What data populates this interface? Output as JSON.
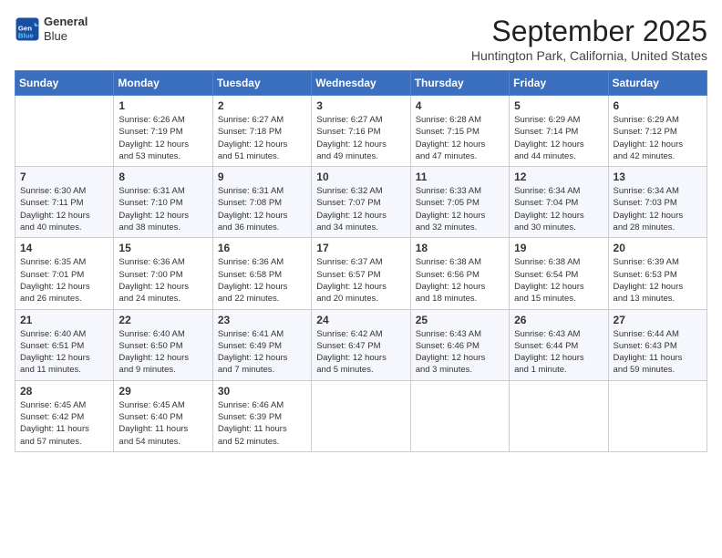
{
  "header": {
    "logo_line1": "General",
    "logo_line2": "Blue",
    "month": "September 2025",
    "location": "Huntington Park, California, United States"
  },
  "weekdays": [
    "Sunday",
    "Monday",
    "Tuesday",
    "Wednesday",
    "Thursday",
    "Friday",
    "Saturday"
  ],
  "weeks": [
    [
      {
        "day": "",
        "info": ""
      },
      {
        "day": "1",
        "info": "Sunrise: 6:26 AM\nSunset: 7:19 PM\nDaylight: 12 hours\nand 53 minutes."
      },
      {
        "day": "2",
        "info": "Sunrise: 6:27 AM\nSunset: 7:18 PM\nDaylight: 12 hours\nand 51 minutes."
      },
      {
        "day": "3",
        "info": "Sunrise: 6:27 AM\nSunset: 7:16 PM\nDaylight: 12 hours\nand 49 minutes."
      },
      {
        "day": "4",
        "info": "Sunrise: 6:28 AM\nSunset: 7:15 PM\nDaylight: 12 hours\nand 47 minutes."
      },
      {
        "day": "5",
        "info": "Sunrise: 6:29 AM\nSunset: 7:14 PM\nDaylight: 12 hours\nand 44 minutes."
      },
      {
        "day": "6",
        "info": "Sunrise: 6:29 AM\nSunset: 7:12 PM\nDaylight: 12 hours\nand 42 minutes."
      }
    ],
    [
      {
        "day": "7",
        "info": "Sunrise: 6:30 AM\nSunset: 7:11 PM\nDaylight: 12 hours\nand 40 minutes."
      },
      {
        "day": "8",
        "info": "Sunrise: 6:31 AM\nSunset: 7:10 PM\nDaylight: 12 hours\nand 38 minutes."
      },
      {
        "day": "9",
        "info": "Sunrise: 6:31 AM\nSunset: 7:08 PM\nDaylight: 12 hours\nand 36 minutes."
      },
      {
        "day": "10",
        "info": "Sunrise: 6:32 AM\nSunset: 7:07 PM\nDaylight: 12 hours\nand 34 minutes."
      },
      {
        "day": "11",
        "info": "Sunrise: 6:33 AM\nSunset: 7:05 PM\nDaylight: 12 hours\nand 32 minutes."
      },
      {
        "day": "12",
        "info": "Sunrise: 6:34 AM\nSunset: 7:04 PM\nDaylight: 12 hours\nand 30 minutes."
      },
      {
        "day": "13",
        "info": "Sunrise: 6:34 AM\nSunset: 7:03 PM\nDaylight: 12 hours\nand 28 minutes."
      }
    ],
    [
      {
        "day": "14",
        "info": "Sunrise: 6:35 AM\nSunset: 7:01 PM\nDaylight: 12 hours\nand 26 minutes."
      },
      {
        "day": "15",
        "info": "Sunrise: 6:36 AM\nSunset: 7:00 PM\nDaylight: 12 hours\nand 24 minutes."
      },
      {
        "day": "16",
        "info": "Sunrise: 6:36 AM\nSunset: 6:58 PM\nDaylight: 12 hours\nand 22 minutes."
      },
      {
        "day": "17",
        "info": "Sunrise: 6:37 AM\nSunset: 6:57 PM\nDaylight: 12 hours\nand 20 minutes."
      },
      {
        "day": "18",
        "info": "Sunrise: 6:38 AM\nSunset: 6:56 PM\nDaylight: 12 hours\nand 18 minutes."
      },
      {
        "day": "19",
        "info": "Sunrise: 6:38 AM\nSunset: 6:54 PM\nDaylight: 12 hours\nand 15 minutes."
      },
      {
        "day": "20",
        "info": "Sunrise: 6:39 AM\nSunset: 6:53 PM\nDaylight: 12 hours\nand 13 minutes."
      }
    ],
    [
      {
        "day": "21",
        "info": "Sunrise: 6:40 AM\nSunset: 6:51 PM\nDaylight: 12 hours\nand 11 minutes."
      },
      {
        "day": "22",
        "info": "Sunrise: 6:40 AM\nSunset: 6:50 PM\nDaylight: 12 hours\nand 9 minutes."
      },
      {
        "day": "23",
        "info": "Sunrise: 6:41 AM\nSunset: 6:49 PM\nDaylight: 12 hours\nand 7 minutes."
      },
      {
        "day": "24",
        "info": "Sunrise: 6:42 AM\nSunset: 6:47 PM\nDaylight: 12 hours\nand 5 minutes."
      },
      {
        "day": "25",
        "info": "Sunrise: 6:43 AM\nSunset: 6:46 PM\nDaylight: 12 hours\nand 3 minutes."
      },
      {
        "day": "26",
        "info": "Sunrise: 6:43 AM\nSunset: 6:44 PM\nDaylight: 12 hours\nand 1 minute."
      },
      {
        "day": "27",
        "info": "Sunrise: 6:44 AM\nSunset: 6:43 PM\nDaylight: 11 hours\nand 59 minutes."
      }
    ],
    [
      {
        "day": "28",
        "info": "Sunrise: 6:45 AM\nSunset: 6:42 PM\nDaylight: 11 hours\nand 57 minutes."
      },
      {
        "day": "29",
        "info": "Sunrise: 6:45 AM\nSunset: 6:40 PM\nDaylight: 11 hours\nand 54 minutes."
      },
      {
        "day": "30",
        "info": "Sunrise: 6:46 AM\nSunset: 6:39 PM\nDaylight: 11 hours\nand 52 minutes."
      },
      {
        "day": "",
        "info": ""
      },
      {
        "day": "",
        "info": ""
      },
      {
        "day": "",
        "info": ""
      },
      {
        "day": "",
        "info": ""
      }
    ]
  ]
}
